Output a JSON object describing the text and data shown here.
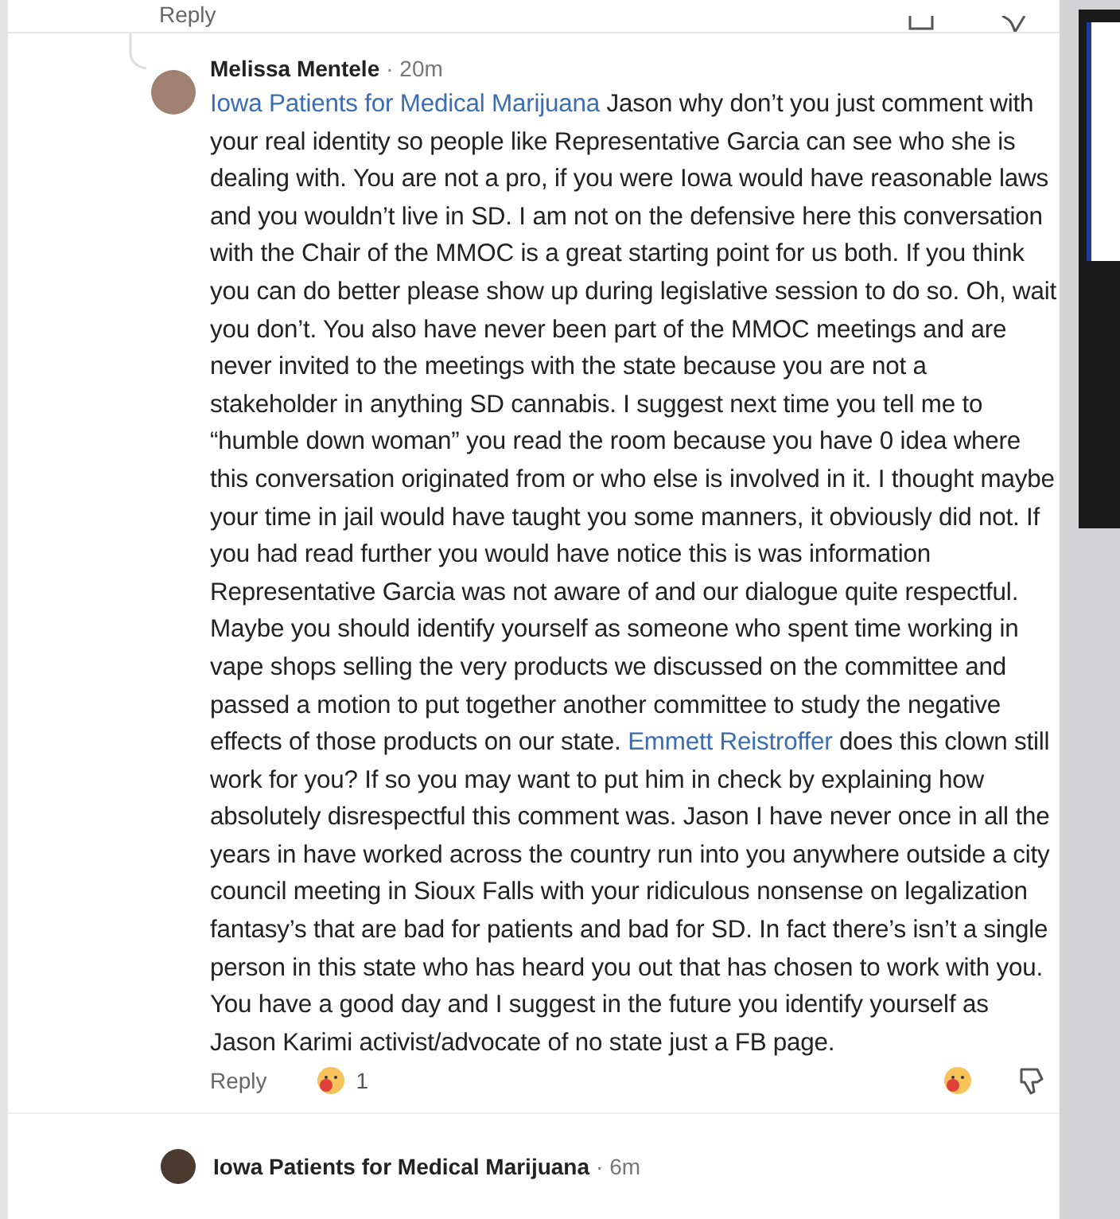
{
  "previous_comment": {
    "reply": "Reply"
  },
  "comment": {
    "author": "Melissa Mentele",
    "time": "· 20m",
    "body": [
      {
        "kind": "mention",
        "text": "Iowa Patients for Medical Marijuana"
      },
      {
        "kind": "text",
        "text": " Jason why don’t you just comment with your real identity so people like Representative Garcia can see who she is dealing with. You are not a pro, if you were Iowa would have reasonable laws and you wouldn’t live in SD. I am not on the defensive here this conversation with the Chair of the MMOC is a great starting point for us both. If you think you can do better please show up during legislative session to do so. Oh, wait you don’t. You also have never been part of the MMOC meetings and are never invited to the meetings with the state because you are not a stakeholder in anything SD cannabis. I suggest next time you tell me to “humble down woman” you read the room because you have 0 idea where this conversation originated from or who else is involved in it. I thought maybe your time in jail would have taught you some manners, it obviously did not. If you had read further you would have notice this is was information Representative Garcia was not aware of and our dialogue quite respectful. Maybe you should identify yourself as someone who spent time working in vape shops selling the very products we discussed on the committee and passed a motion to put together another committee to study the negative effects of those products on our state. "
      },
      {
        "kind": "mention",
        "text": "Emmett Reistroffer"
      },
      {
        "kind": "text",
        "text": " does this clown still work for you? If so you may want to put him in check by explaining how absolutely disrespectful this comment was. Jason I have never once in all the years in have worked across the country run into you anywhere outside a city council meeting in Sioux Falls with your ridiculous nonsense on legalization fantasy’s that are bad for patients and bad for SD. In fact there’s isn’t a single person in this state who has heard you out that has chosen to work with you. You have a good day and I suggest in the future you identify yourself as Jason Karimi activist/advocate of no state just a FB page."
      }
    ],
    "reply": "Reply",
    "reaction_count": "1"
  },
  "next_comment": {
    "author": "Iowa Patients for Medical Marijuana",
    "time": "· 6m"
  }
}
